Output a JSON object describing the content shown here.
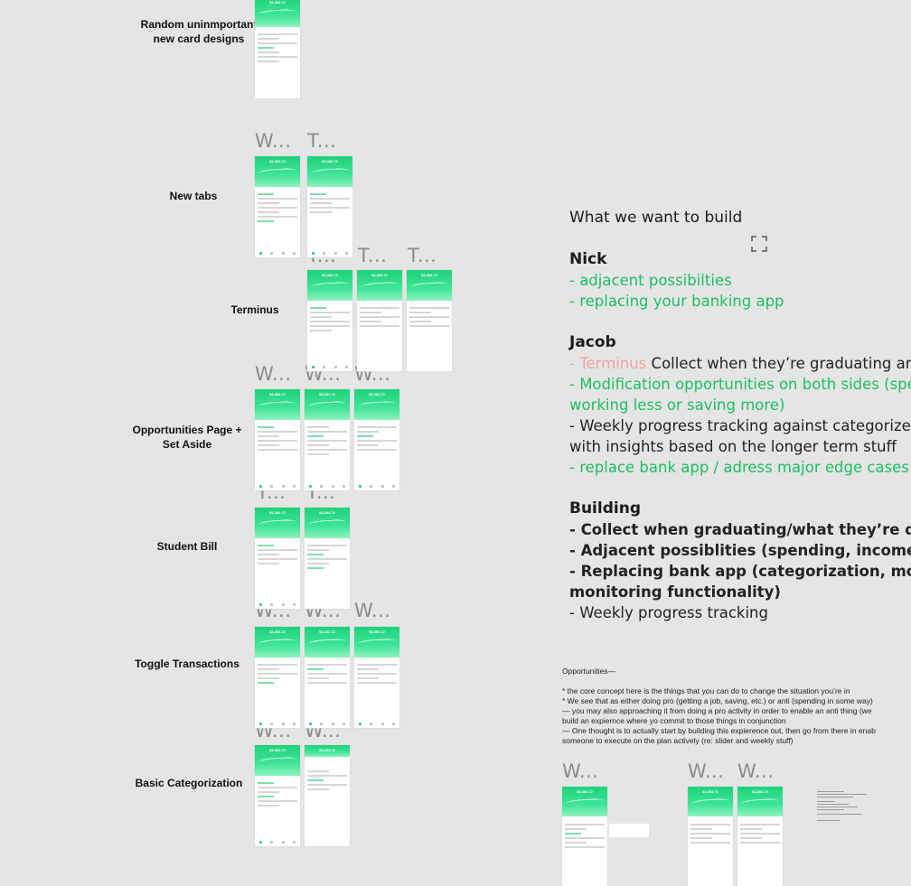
{
  "canvas": {
    "section_labels": [
      {
        "id": "random",
        "text": "Random uninmportant new card designs"
      },
      {
        "id": "new-tabs",
        "text": "New tabs"
      },
      {
        "id": "terminus",
        "text": "Terminus"
      },
      {
        "id": "opportunities",
        "text": "Opportunities Page + Set Aside"
      },
      {
        "id": "student-bill",
        "text": "Student Bill"
      },
      {
        "id": "toggle",
        "text": "Toggle Transactions"
      },
      {
        "id": "basic",
        "text": "Basic Categorization"
      }
    ],
    "frame_titles": {
      "w": "W...",
      "t": "T..."
    },
    "phone_balance": "$3,384.72"
  },
  "notes": {
    "title": "What we want to build",
    "nick": {
      "name": "Nick",
      "items": [
        "- adjacent possibilties",
        "- replacing your banking app"
      ]
    },
    "jacob": {
      "name": "Jacob",
      "terminus_prefix": "- Terminus",
      "terminus_rest": " Collect when they’re graduating and",
      "item2_line1": "- Modification opportunities on both sides (spe",
      "item2_line2": "working less or saving more)",
      "item3_line1": "- Weekly progress tracking against categorized",
      "item3_line2": "with insights based on the longer term stuff",
      "item4": "- replace bank app / adress major edge cases f"
    },
    "building": {
      "name": "Building",
      "item1": "- Collect when graduating/what they’re doing",
      "item2": "- Adjacent possiblities (spending, income, sa",
      "item3_line1": "- Replacing bank app (categorization, more h",
      "item3_line2": "monitoring functionality)",
      "item4": "- Weekly progress tracking"
    }
  },
  "opportunities_text": {
    "title": "Opportunities—",
    "lines": [
      "* the core concept here is the things that you can do to change the situation you’re in",
      "* We see that as either doing pro (getting a job, saving, etc.) or anti (spending in some way)",
      "— you may also approaching it from doing a pro activity in order to enable an anti thing (we",
      "build an expiernce where yo commit to those things in conjunction",
      "— One thought is to actually start by building this expierence out, then go from there in enab",
      "someone to execute on the plan actively (re: slider and weekly stuff)"
    ]
  },
  "colors": {
    "accent_green": "#1bbf62",
    "terminus_pink": "#f2a0a0",
    "canvas_bg": "#e5e5e5"
  },
  "icons": [
    "expand-icon"
  ]
}
